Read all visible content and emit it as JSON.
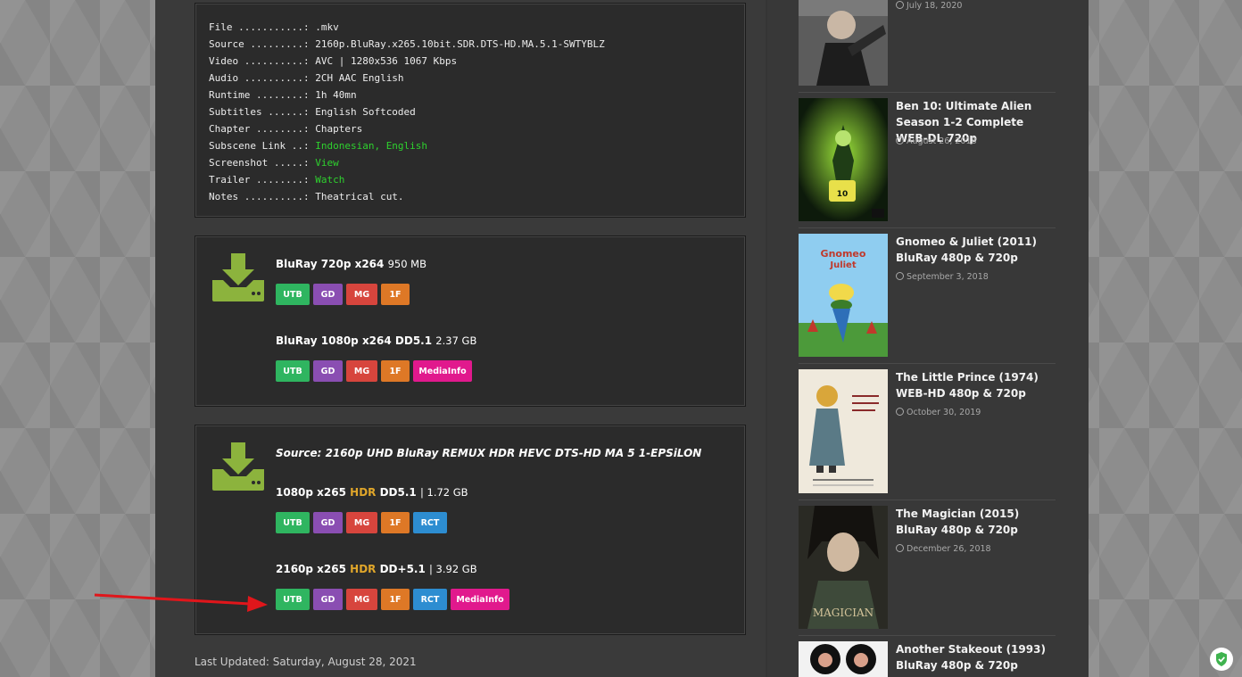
{
  "nfo": {
    "rows": [
      {
        "key": "File ...........: ",
        "value": ".mkv",
        "value_color": "white"
      },
      {
        "key": "Source .........: ",
        "value": "2160p.BluRay.x265.10bit.SDR.DTS-HD.MA.5.1-SWTYBLZ",
        "value_color": "white"
      },
      {
        "key": "Video ..........: ",
        "value": "AVC | 1280x536 1067 Kbps",
        "value_color": "white"
      },
      {
        "key": "Audio ..........: ",
        "value": "2CH AAC English",
        "value_color": "white"
      },
      {
        "key": "Runtime ........: ",
        "value": "1h 40mn",
        "value_color": "white"
      },
      {
        "key": "Subtitles ......: ",
        "value": "English Softcoded",
        "value_color": "white"
      },
      {
        "key": "Chapter ........: ",
        "value": "Chapters",
        "value_color": "white"
      },
      {
        "key": "Subscene Link ..: ",
        "value": "Indonesian, English",
        "value_color": "green"
      },
      {
        "key": "Screenshot .....: ",
        "value": "View",
        "value_color": "green"
      },
      {
        "key": "Trailer ........: ",
        "value": "Watch",
        "value_color": "green"
      },
      {
        "key": "Notes ..........: ",
        "value": "Theatrical cut.",
        "value_color": "white"
      }
    ]
  },
  "download_box_1": {
    "items": [
      {
        "title": "BluRay 720p x264",
        "size": "950 MB",
        "buttons": [
          "UTB",
          "GD",
          "MG",
          "1F"
        ]
      },
      {
        "title": "BluRay 1080p x264 DD5.1",
        "size": "2.37 GB",
        "buttons": [
          "UTB",
          "GD",
          "MG",
          "1F",
          "MediaInfo"
        ]
      }
    ]
  },
  "download_box_2": {
    "source": "Source: 2160p UHD BluRay REMUX HDR HEVC DTS-HD MA 5 1-EPSiLON",
    "items": [
      {
        "title_a": "1080p x265",
        "hdr": "HDR",
        "title_b": "DD5.1",
        "size": "| 1.72 GB",
        "buttons": [
          "UTB",
          "GD",
          "MG",
          "1F",
          "RCT"
        ]
      },
      {
        "title_a": "2160p x265",
        "hdr": "HDR",
        "title_b": "DD+5.1",
        "size": "| 3.92 GB",
        "buttons": [
          "UTB",
          "GD",
          "MG",
          "1F",
          "RCT",
          "MediaInfo"
        ]
      }
    ]
  },
  "last_updated": "Last Updated: Saturday, August 28, 2021",
  "sidebar": {
    "posts": [
      {
        "title": "",
        "date": "July 18, 2020"
      },
      {
        "title": "Ben 10: Ultimate Alien Season 1-2 Complete WEB-DL 720p",
        "date": "August 26, 2018"
      },
      {
        "title": "Gnomeo & Juliet (2011) BluRay 480p & 720p",
        "date": "September 3, 2018"
      },
      {
        "title": "The Little Prince (1974) WEB-HD 480p & 720p",
        "date": "October 30, 2019"
      },
      {
        "title": "The Magician (2015) BluRay 480p & 720p",
        "date": "December 26, 2018"
      },
      {
        "title": "Another Stakeout (1993) BluRay 480p & 720p",
        "date": ""
      }
    ]
  },
  "colors": {
    "utb": "#2fb560",
    "gd": "#8a4eb2",
    "mg": "#d7453d",
    "1f": "#de7826",
    "rct": "#2d8dd1",
    "mediainfo": "#e1198d",
    "hdr": "#e0a62a",
    "nfo_link": "#2ed12e",
    "arrow": "#e0161b",
    "download_icon": "#8cb33d"
  }
}
